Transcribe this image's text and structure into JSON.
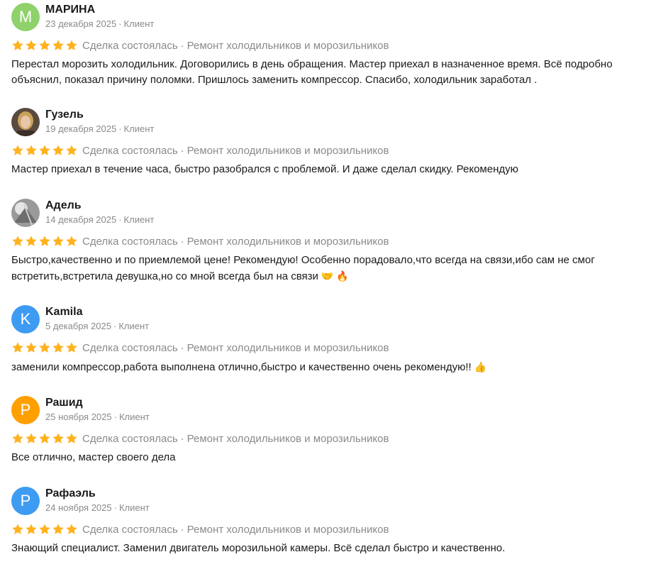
{
  "reviews": [
    {
      "avatar_letter": "М",
      "avatar_color": "#8fd16a",
      "avatar_kind": "letter",
      "name": "МАРИНА",
      "date": "23 декабря 2025",
      "role": "Клиент",
      "rating": 5,
      "deal_status": "Сделка состоялась",
      "service": "Ремонт холодильников и морозильников",
      "text": "Перестал морозить холодильник. Договорились в день обращения. Мастер приехал в назначенное время. Всё подробно объяснил, показал причину поломки. Пришлось заменить компрессор. Спасибо, холодильник заработал ."
    },
    {
      "avatar_kind": "photo",
      "name": "Гузель",
      "date": "19 декабря 2025",
      "role": "Клиент",
      "rating": 5,
      "deal_status": "Сделка состоялась",
      "service": "Ремонт холодильников и морозильников",
      "text": "Мастер приехал в течение часа, быстро разобрался с проблемой. И даже сделал скидку. Рекомендую"
    },
    {
      "avatar_kind": "photo-gray",
      "name": "Адель",
      "date": "14 декабря 2025",
      "role": "Клиент",
      "rating": 5,
      "deal_status": "Сделка состоялась",
      "service": "Ремонт холодильников и морозильников",
      "text": "Быстро,качественно и по приемлемой цене! Рекомендую! Особенно порадовало,что всегда на связи,ибо сам не смог встретить,встретила девушка,но со мной всегда был на связи",
      "emoji": "🤝 🔥"
    },
    {
      "avatar_letter": "K",
      "avatar_color": "#3d9bf2",
      "avatar_kind": "letter",
      "name": "Kamila",
      "date": "5 декабря 2025",
      "role": "Клиент",
      "rating": 5,
      "deal_status": "Сделка состоялась",
      "service": "Ремонт холодильников и морозильников",
      "text": "заменили компрессор,работа выполнена отлично,быстро и качественно очень рекомендую!!",
      "emoji": "👍"
    },
    {
      "avatar_letter": "Р",
      "avatar_color": "#ffa000",
      "avatar_kind": "letter",
      "name": "Рашид",
      "date": "25 ноября 2025",
      "role": "Клиент",
      "rating": 5,
      "deal_status": "Сделка состоялась",
      "service": "Ремонт холодильников и морозильников",
      "text": "Все отлично, мастер своего дела"
    },
    {
      "avatar_letter": "Р",
      "avatar_color": "#3d9bf2",
      "avatar_kind": "letter",
      "name": "Рафаэль",
      "date": "24 ноября 2025",
      "role": "Клиент",
      "rating": 5,
      "deal_status": "Сделка состоялась",
      "service": "Ремонт холодильников и морозильников",
      "text": "Знающий специалист. Заменил двигатель морозильной камеры. Всё сделал быстро и качественно."
    }
  ],
  "colors": {
    "star": "#ffb21e",
    "muted_text": "#8a8a8a",
    "main_text": "#1a1a1a"
  },
  "separator": "·"
}
